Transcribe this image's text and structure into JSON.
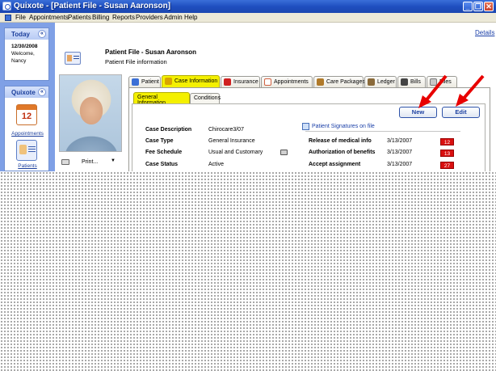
{
  "window": {
    "title": "Quixote - [Patient File - Susan Aaronson]",
    "minimize": "_",
    "restore": "❐",
    "close": "✕"
  },
  "menu": [
    "File",
    "Appointments",
    "Patients",
    "Billing",
    "Reports",
    "Providers",
    "Admin",
    "Help"
  ],
  "details_link": "Details",
  "sidebar": {
    "today": {
      "header": "Today",
      "date": "12/30/2008",
      "welcome": "Welcome,",
      "user": "Nancy",
      "collapse": "«"
    },
    "quixote": {
      "header": "Quixote",
      "collapse": "«",
      "calendar_number": "12",
      "items": [
        {
          "label": "Appointments",
          "icon": "calendar-icon"
        },
        {
          "label": "Patients",
          "icon": "patient-card-icon"
        }
      ]
    }
  },
  "header": {
    "title": "Patient File - Susan Aaronson",
    "subtitle": "Patient File information"
  },
  "print": {
    "label": "Print...",
    "arrow": "▼"
  },
  "tabs": [
    {
      "label": "Patient",
      "icon": "person-icon",
      "color": "#3b6fd6"
    },
    {
      "label": "Case Information",
      "icon": "case-icon",
      "color": "#d9a400"
    },
    {
      "label": "Insurance",
      "icon": "insurance-icon",
      "color": "#d02020"
    },
    {
      "label": "Appointments",
      "icon": "calendar-icon",
      "color": "#d06040"
    },
    {
      "label": "Care Packages",
      "icon": "package-icon",
      "color": "#b07a2a"
    },
    {
      "label": "Ledger",
      "icon": "ledger-icon",
      "color": "#8a6a3a"
    },
    {
      "label": "Bills",
      "icon": "bills-icon",
      "color": "#444444"
    },
    {
      "label": "Files",
      "icon": "files-icon",
      "color": "#7a7a7a"
    }
  ],
  "subtabs": [
    "General Information",
    "Conditions"
  ],
  "buttons": {
    "new": "New",
    "edit": "Edit"
  },
  "case": {
    "description_label": "Case Description",
    "description_value": "Chirocare3/07",
    "type_label": "Case Type",
    "type_value": "General Insurance",
    "fee_label": "Fee Schedule",
    "fee_value": "Usual and Customary",
    "status_label": "Case Status",
    "status_value": "Active"
  },
  "signatures": {
    "link": "Patient Signatures on file",
    "rows": [
      {
        "label": "Release of medical info",
        "date": "3/13/2007",
        "badge": "12"
      },
      {
        "label": "Authorization of benefits",
        "date": "3/13/2007",
        "badge": "13"
      },
      {
        "label": "Accept assignment",
        "date": "3/13/2007",
        "badge": "27"
      }
    ]
  },
  "colors": {
    "accent_yellow": "#f4f000",
    "arrow_red": "#e80000",
    "titlebar_blue": "#2455c4"
  }
}
